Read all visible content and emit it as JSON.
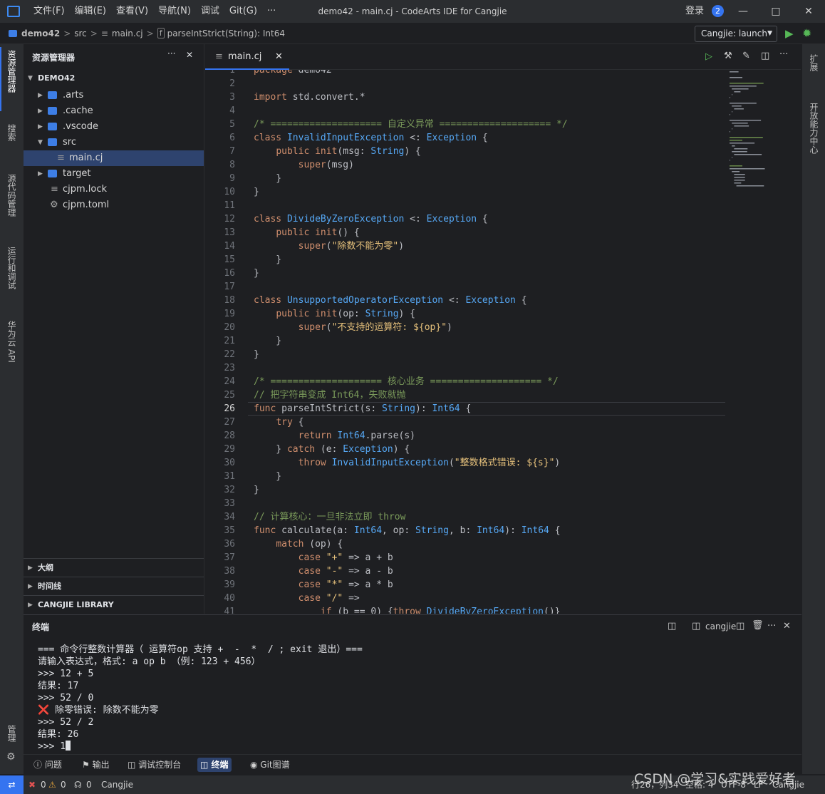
{
  "menu": [
    "文件(F)",
    "编辑(E)",
    "查看(V)",
    "导航(N)",
    "调试",
    "Git(G)",
    "···"
  ],
  "window_title": "demo42 - main.cj - CodeArts IDE for Cangjie",
  "login": "登录",
  "notification_count": "2",
  "breadcrumb": {
    "project": "demo42",
    "folder": "src",
    "file": "main.cj",
    "symbol": "parseIntStrict(String): Int64"
  },
  "run_config": "Cangjie: launch",
  "activity_tabs": [
    "资源管理器",
    "搜索",
    "源代码管理",
    "运行和调试",
    "华为云 API",
    "管理"
  ],
  "right_tabs": [
    "扩展",
    "开放能力中心"
  ],
  "explorer": {
    "title": "资源管理器",
    "root": "DEMO42",
    "items": [
      ".arts",
      ".cache",
      ".vscode",
      "src",
      "main.cj",
      "target",
      "cjpm.lock",
      "cjpm.toml"
    ],
    "sections": [
      "大纲",
      "时间线",
      "CANGJIE LIBRARY"
    ]
  },
  "editor": {
    "tab_label": "main.cj",
    "current_line": 26,
    "line_numbers": [
      "1",
      "2",
      "3",
      "4",
      "5",
      "6",
      "7",
      "8",
      "9",
      "10",
      "11",
      "12",
      "13",
      "14",
      "15",
      "16",
      "17",
      "18",
      "19",
      "20",
      "21",
      "22",
      "23",
      "24",
      "25",
      "26",
      "27",
      "28",
      "29",
      "30",
      "31",
      "32",
      "33",
      "34",
      "35",
      "36",
      "37",
      "38",
      "39",
      "40",
      "41"
    ],
    "lines": [
      "package demo42",
      "",
      "import std.convert.*",
      "",
      "/* ==================== 自定义异常 ==================== */",
      "class InvalidInputException <: Exception {",
      "    public init(msg: String) {",
      "        super(msg)",
      "    }",
      "}",
      "",
      "class DivideByZeroException <: Exception {",
      "    public init() {",
      "        super(\"除数不能为零\")",
      "    }",
      "}",
      "",
      "class UnsupportedOperatorException <: Exception {",
      "    public init(op: String) {",
      "        super(\"不支持的运算符: ${op}\")",
      "    }",
      "}",
      "",
      "/* ==================== 核心业务 ==================== */",
      "// 把字符串变成 Int64，失败就抛",
      "func parseIntStrict(s: String): Int64 {",
      "    try {",
      "        return Int64.parse(s)",
      "    } catch (e: Exception) {",
      "        throw InvalidInputException(\"整数格式错误: ${s}\")",
      "    }",
      "}",
      "",
      "// 计算核心：一旦非法立即 throw",
      "func calculate(a: Int64, op: String, b: Int64): Int64 {",
      "    match (op) {",
      "        case \"+\" => a + b",
      "        case \"-\" => a - b",
      "        case \"*\" => a * b",
      "        case \"/\" =>",
      "            if (b == 0) {throw DivideByZeroException()}"
    ]
  },
  "terminal": {
    "title": "终端",
    "shell": "cangjie",
    "lines": [
      "=== 命令行整数计算器（ 运算符op 支持 +  -  *  / ; exit 退出）===",
      "请输入表达式，格式: a op b （例: 123 + 456）",
      ">>> 12 + 5",
      "结果: 17",
      ">>> 52 / 0",
      "❌ 除零错误: 除数不能为零",
      ">>> 52 / 2",
      "结果: 26",
      ">>> 1"
    ]
  },
  "bottom_tabs": [
    "问题",
    "输出",
    "调试控制台",
    "终端",
    "Git图谱"
  ],
  "status": {
    "errors": "0",
    "warnings": "0",
    "ports": "0",
    "lang": "Cangjie",
    "position": "行26，列34",
    "spaces": "空格: 4",
    "encoding": "UTF-8",
    "eol": "LF",
    "language_mode": "Cangjie"
  },
  "watermark": "CSDN @学习&实践爱好者"
}
